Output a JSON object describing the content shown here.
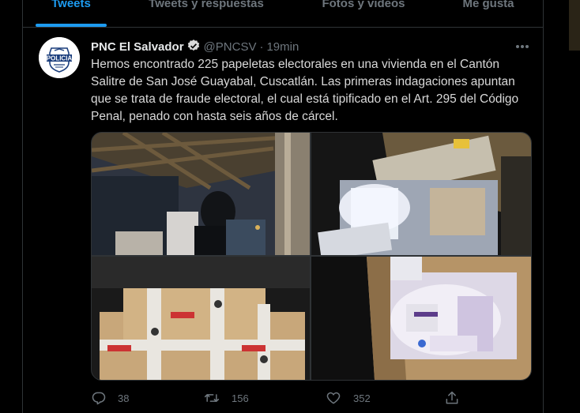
{
  "tabs": [
    {
      "label": "Tweets",
      "active": true
    },
    {
      "label": "Tweets y respuestas",
      "active": false
    },
    {
      "label": "Fotos y videos",
      "active": false
    },
    {
      "label": "Me gusta",
      "active": false
    }
  ],
  "tweet": {
    "author": {
      "name": "PNC El Salvador",
      "handle": "@PNCSV",
      "verified": true,
      "avatar_text": "POLICIA"
    },
    "separator": "·",
    "time": "19min",
    "text": "Hemos encontrado 225 papeletas electorales en una vivienda en el Cantón Salitre de San José Guayabal, Cuscatlán. Las primeras indagaciones apuntan que se trata de fraude electoral, el cual está tipificado en el Art. 295 del Código Penal, penado con hasta seis años de cárcel.",
    "media_count": 4,
    "actions": {
      "reply_count": "38",
      "retweet_count": "156",
      "like_count": "352"
    }
  },
  "colors": {
    "accent": "#1d9bf0",
    "background": "#000000",
    "muted": "#6e767d",
    "border": "#2f3336"
  },
  "icons": [
    "verified-badge-icon",
    "more-icon",
    "reply-icon",
    "retweet-icon",
    "like-icon",
    "share-icon"
  ]
}
